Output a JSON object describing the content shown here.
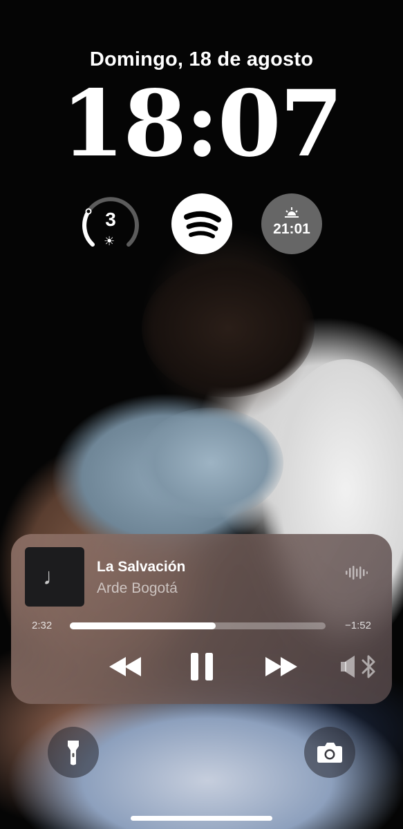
{
  "lockscreen": {
    "date": "Domingo, 18 de agosto",
    "time": "18:07"
  },
  "widgets": {
    "uv_index": {
      "value": "3",
      "icon": "sun-icon",
      "gauge_level": 0.27
    },
    "spotify": {
      "icon": "spotify-icon"
    },
    "sunset": {
      "time": "21:01",
      "icon": "sunset-icon"
    }
  },
  "now_playing": {
    "title": "La Salvación",
    "artist": "Arde Bogotá",
    "elapsed": "2:32",
    "remaining": "−1:52",
    "progress": 0.57,
    "artwork_icon": "music-note-icon",
    "artwork_glyph": "♩",
    "controls": [
      "rewind-icon",
      "pause-icon",
      "fast-forward-icon",
      "bluetooth-speaker-icon"
    ]
  },
  "quick_actions": {
    "left": "flashlight-icon",
    "right": "camera-icon"
  },
  "colors": {
    "text": "#ffffff",
    "widget_gray": "#787878",
    "artwork_bg": "#1c1c1e"
  }
}
